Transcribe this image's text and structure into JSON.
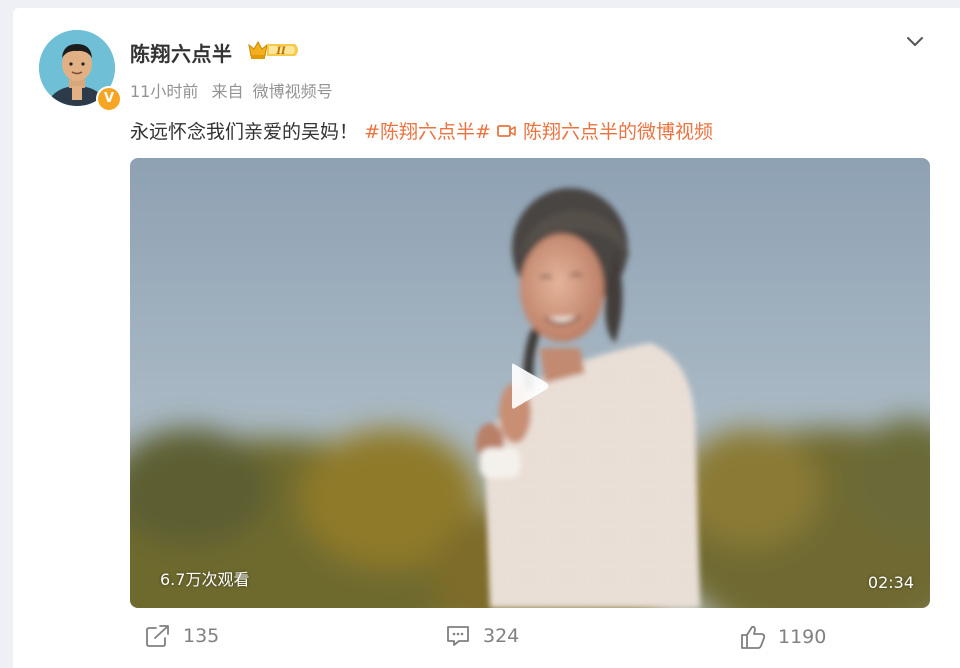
{
  "post": {
    "username": "陈翔六点半",
    "level_badge_text": "II",
    "time": "11小时前",
    "source_prefix": "来自",
    "source": "微博视频号",
    "text": "永远怀念我们亲爱的吴妈！",
    "hashtag": "#陈翔六点半#",
    "video_link_text": "陈翔六点半的微博视频",
    "verified_badge": "V"
  },
  "video": {
    "views": "6.7万次观看",
    "duration": "02:34"
  },
  "actions": {
    "share_count": "135",
    "comment_count": "324",
    "like_count": "1190"
  },
  "colors": {
    "accent": "#eb7340",
    "text": "#333333",
    "meta": "#939393",
    "action": "#808080"
  },
  "icons": [
    "chevron-down-icon",
    "play-icon",
    "share-icon",
    "comment-icon",
    "like-icon",
    "video-link-icon",
    "crown-icon"
  ]
}
